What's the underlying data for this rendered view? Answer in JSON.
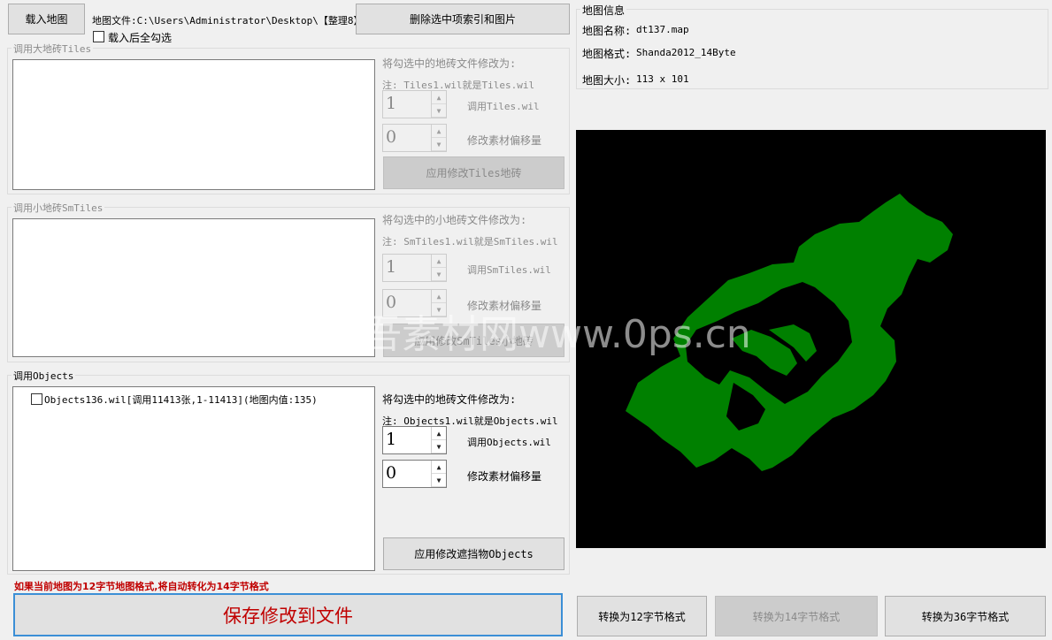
{
  "toolbar": {
    "load_map": "载入地图",
    "map_file_label": "地图文件:C:\\Users\\Administrator\\Desktop\\【整理8】:",
    "delete_selected": "删除选中项索引和图片",
    "check_all_after_load": "载入后全勾选"
  },
  "tiles": {
    "title": "调用大地砖Tiles",
    "modify_hint": "将勾选中的地砖文件修改为:",
    "note": "注: Tiles1.wil就是Tiles.wil",
    "index_value": "1",
    "index_label": "调用Tiles.wil",
    "offset_value": "0",
    "offset_label": "修改素材偏移量",
    "apply": "应用修改Tiles地砖"
  },
  "smtiles": {
    "title": "调用小地砖SmTiles",
    "modify_hint": "将勾选中的小地砖文件修改为:",
    "note": "注: SmTiles1.wil就是SmTiles.wil",
    "index_value": "1",
    "index_label": "调用SmTiles.wil",
    "offset_value": "0",
    "offset_label": "修改素材偏移量",
    "apply": "应用修改SmTiles小地砖"
  },
  "objects": {
    "title": "调用Objects",
    "items": [
      {
        "label": "Objects136.wil[调用11413张,1-11413](地图内值:135)",
        "checked": false
      }
    ],
    "modify_hint": "将勾选中的地砖文件修改为:",
    "note": "注: Objects1.wil就是Objects.wil",
    "index_value": "1",
    "index_label": "调用Objects.wil",
    "offset_value": "0",
    "offset_label": "修改素材偏移量",
    "apply": "应用修改遮挡物Objects"
  },
  "footer": {
    "warning": "如果当前地图为12字节地图格式,将自动转化为14字节格式",
    "save": "保存修改到文件",
    "warning_color": "#c00000"
  },
  "map_info": {
    "title": "地图信息",
    "name_label": "地图名称:",
    "name_value": "dt137.map",
    "format_label": "地图格式:",
    "format_value": "Shanda2012_14Byte",
    "size_label": "地图大小:",
    "size_value": "113 x 101"
  },
  "convert": {
    "to12": "转换为12字节格式",
    "to14": "转换为14字节格式",
    "to36": "转换为36字节格式"
  },
  "preview": {
    "map_color": "#008000",
    "background": "#000000"
  },
  "watermark": "吾素材网www.0ps.cn"
}
